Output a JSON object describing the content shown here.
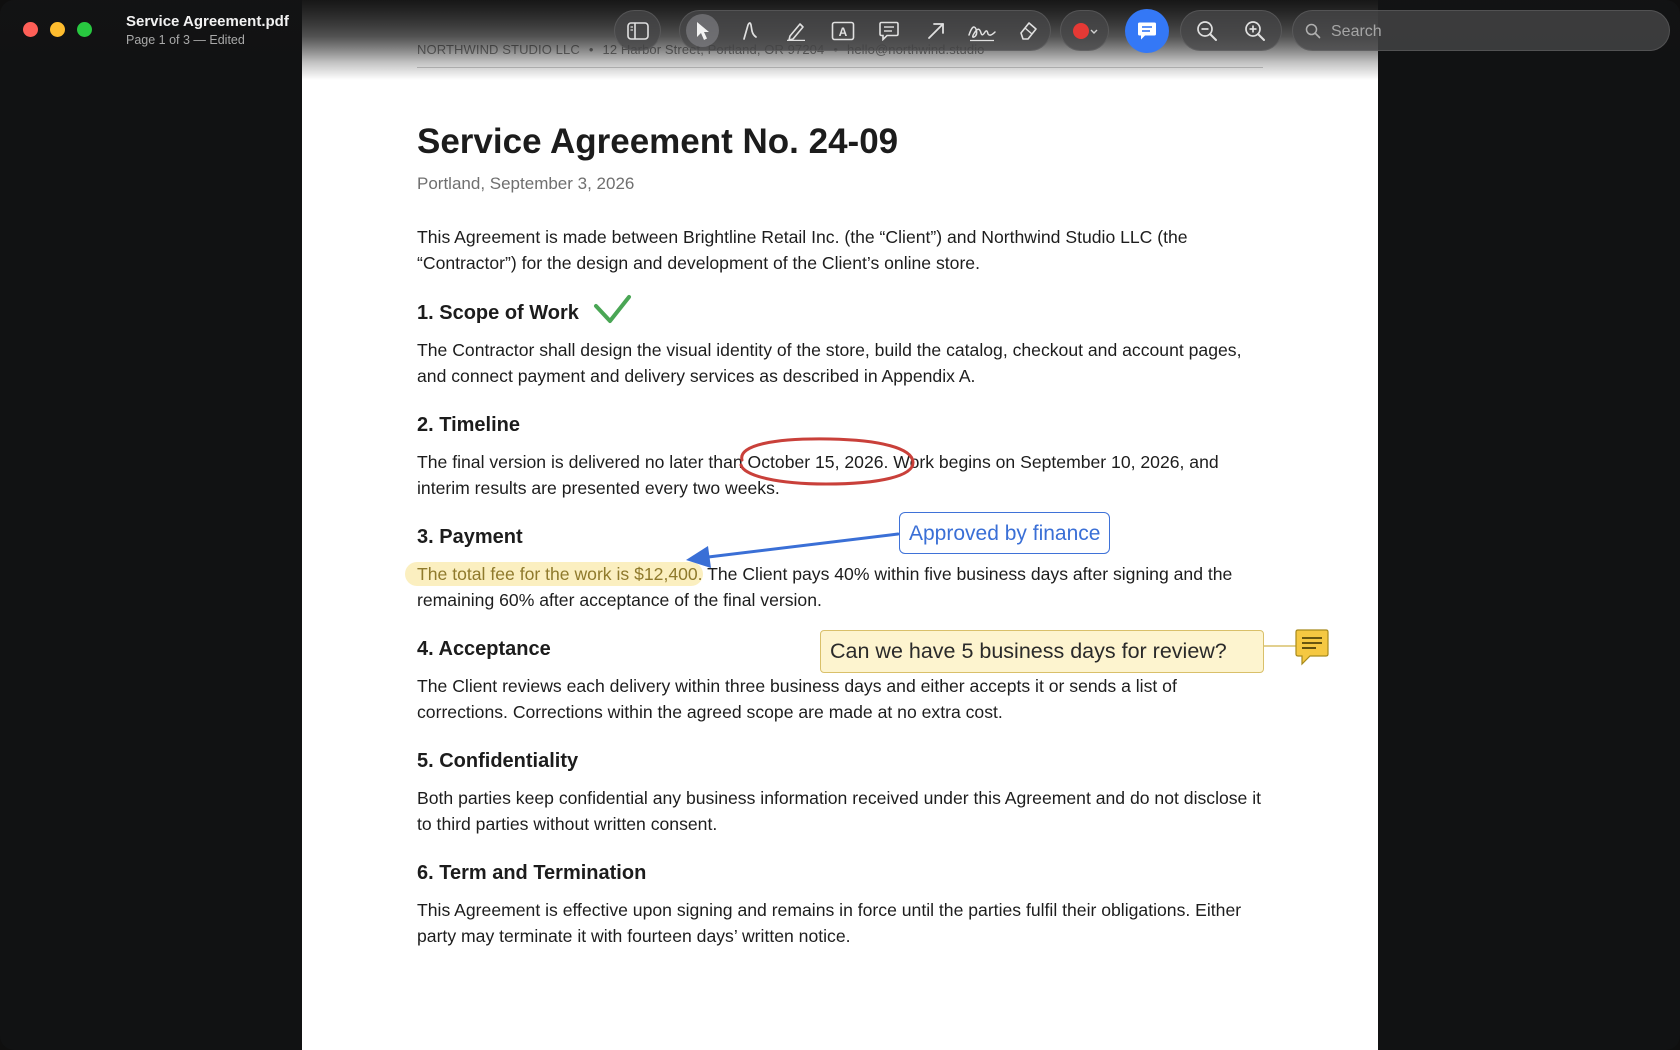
{
  "window": {
    "title": "Service Agreement.pdf",
    "subtitle": "Page 1 of 3 — Edited"
  },
  "toolbar": {
    "tools": [
      "sidebar-toggle",
      "select",
      "sketch",
      "highlight",
      "text-box",
      "note",
      "arrow",
      "signature",
      "eraser",
      "color",
      "comments",
      "zoom-out",
      "zoom-in"
    ],
    "active_tool": "select",
    "color_value": "#e53935",
    "search_placeholder": "Search"
  },
  "document": {
    "header": {
      "company": "NORTHWIND STUDIO LLC",
      "address": "12 Harbor Street, Portland, OR 97204",
      "email": "hello@northwind.studio",
      "separator": "•"
    },
    "title": "Service Agreement No. 24-09",
    "place_date": "Portland, September 3, 2026",
    "intro": "This Agreement is made between Brightline Retail Inc. (the “Client”) and Northwind Studio LLC (the “Contractor”) for the design and development of the Client’s online store.",
    "sections": [
      {
        "heading": "1. Scope of Work",
        "body": "The Contractor shall design the visual identity of the store, build the catalog, checkout and account pages, and connect payment and delivery services as described in Appendix A."
      },
      {
        "heading": "2. Timeline",
        "body": "The final version is delivered no later than October 15, 2026. Work begins on September 10, 2026, and interim results are presented every two weeks."
      },
      {
        "heading": "3. Payment",
        "body_highlighted": "The total fee for the work is $12,400.",
        "body_rest": " The Client pays 40% within five business days after signing and the remaining 60% after acceptance of the final version."
      },
      {
        "heading": "4. Acceptance",
        "body": "The Client reviews each delivery within three business days and either accepts it or sends a list of corrections. Corrections within the agreed scope are made at no extra cost."
      },
      {
        "heading": "5. Confidentiality",
        "body": "Both parties keep confidential any business information received under this Agreement and do not disclose it to third parties without written consent."
      },
      {
        "heading": "6. Term and Termination",
        "body": "This Agreement is effective upon signing and remains in force until the parties fulfil their obligations. Either party may terminate it with fourteen days’ written notice."
      }
    ]
  },
  "annotations": {
    "checkmark_color": "#4aa655",
    "circle_color": "#c9403a",
    "approved_label": "Approved by finance",
    "approved_color": "#3a6fd6",
    "note_text": "Can we have 5 business days for review?",
    "highlight_color": "#fbefc0",
    "note_color": "#f5c842"
  }
}
